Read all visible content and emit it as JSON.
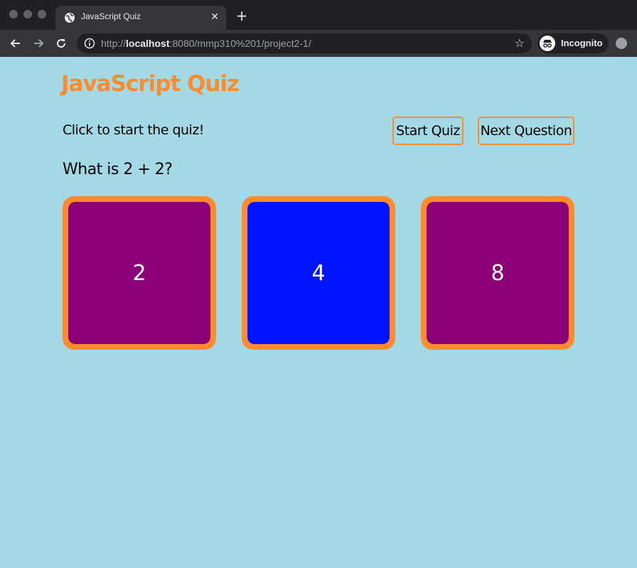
{
  "browser": {
    "tab_title": "JavaScript Quiz",
    "url_prefix": "http://",
    "url_host": "localhost",
    "url_rest": ":8080/mmp310%201/project2-1/",
    "profile_label": "Incognito"
  },
  "page": {
    "title": "JavaScript Quiz",
    "status": "Click to start the quiz!",
    "start_label": "Start Quiz",
    "next_label": "Next Question",
    "question": "What is 2 + 2?"
  },
  "answers": [
    {
      "label": "2",
      "color": "#8b0077"
    },
    {
      "label": "4",
      "color": "#0014ff"
    },
    {
      "label": "8",
      "color": "#8b0077"
    }
  ],
  "colors": {
    "page_bg": "#a3d8e5",
    "accent": "#ff8b2f"
  }
}
